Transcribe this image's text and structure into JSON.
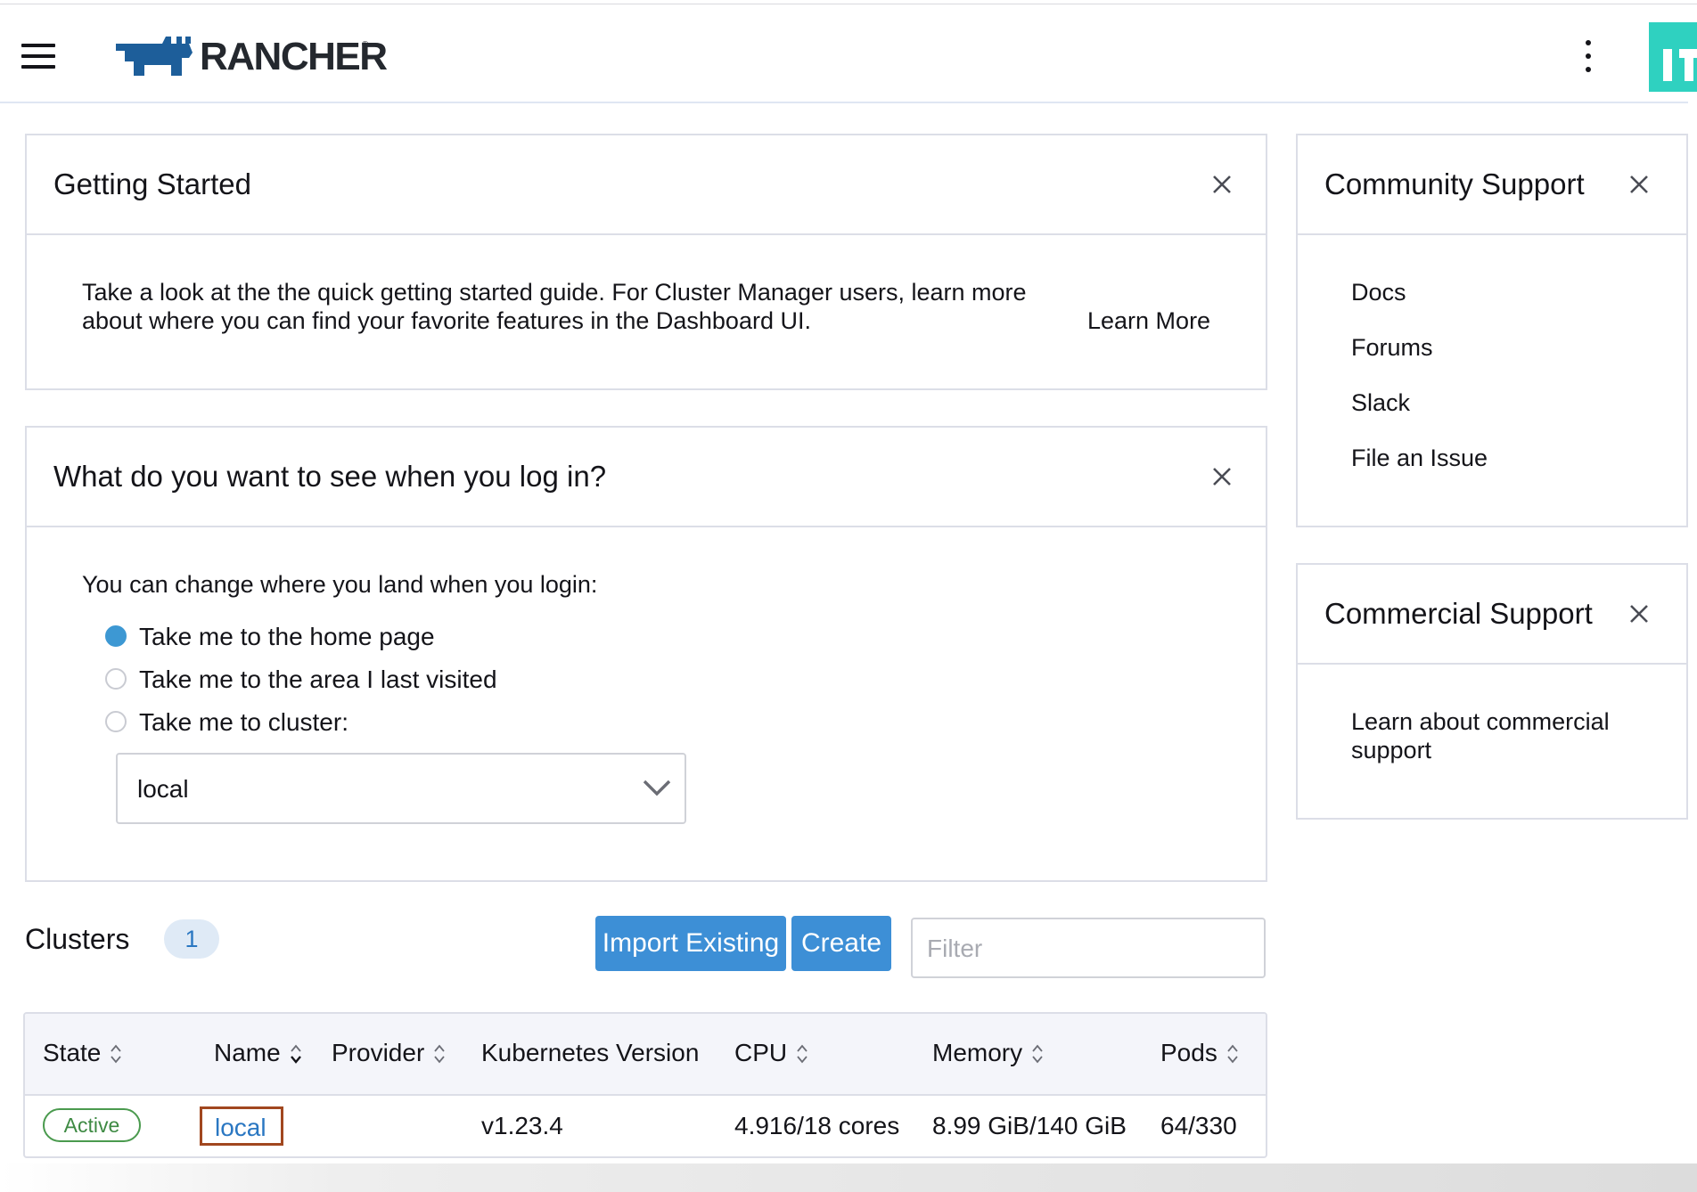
{
  "header": {
    "brand": "RANCHER",
    "brand_mark": "®",
    "menu_icon": "hamburger-menu-icon",
    "more_icon": "vertical-ellipsis-icon",
    "colors": {
      "brand_blue": "#1d5e9a",
      "accent_teal": "#2fd1c0"
    }
  },
  "getting_started": {
    "title": "Getting Started",
    "line1": "Take a look at the the quick getting started guide. For Cluster Manager users, learn more",
    "line2": "about where you can find your favorite features in the Dashboard UI.",
    "link": "Learn More"
  },
  "login_pref": {
    "title": "What do you want to see when you log in?",
    "prompt": "You can change where you land when you login:",
    "options": [
      {
        "label": "Take me to the home page",
        "selected": true
      },
      {
        "label": "Take me to the area I last visited",
        "selected": false
      },
      {
        "label": "Take me to cluster:",
        "selected": false
      }
    ],
    "cluster_select": "local"
  },
  "community_support": {
    "title": "Community Support",
    "links": [
      "Docs",
      "Forums",
      "Slack",
      "File an Issue"
    ]
  },
  "commercial_support": {
    "title": "Commercial Support",
    "link_line1": "Learn about commercial",
    "link_line2": "support"
  },
  "clusters": {
    "title": "Clusters",
    "count": "1",
    "import_label": "Import Existing",
    "create_label": "Create",
    "filter_placeholder": "Filter",
    "columns": [
      "State",
      "Name",
      "Provider",
      "Kubernetes Version",
      "CPU",
      "Memory",
      "Pods"
    ],
    "rows": [
      {
        "state": "Active",
        "name": "local",
        "provider": "",
        "version": "v1.23.4",
        "cpu": "4.916/18 cores",
        "memory": "8.99 GiB/140 GiB",
        "pods": "64/330"
      }
    ]
  }
}
